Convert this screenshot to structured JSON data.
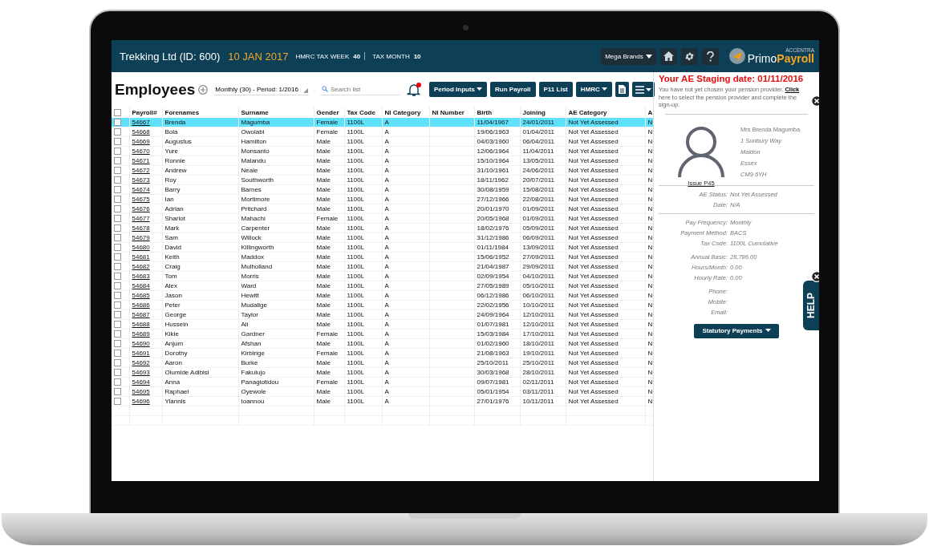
{
  "header": {
    "company": "Trekking Ltd (ID: 600)",
    "date": "10 JAN 2017",
    "tax_week_label": "HMRC TAX WEEK",
    "tax_week": "40",
    "tax_month_label": "TAX MONTH",
    "tax_month": "10",
    "company_select": "Mega Brands",
    "logo_small": "ACCENTRA",
    "logo_name": [
      "Primo",
      "Payroll"
    ]
  },
  "toolbar": {
    "title": "Employees",
    "period_select": "Monthly (30) - Period: 1/2016",
    "search": {
      "placeholder": "Search list"
    },
    "notification": true,
    "buttons": [
      {
        "label": "Period Inputs",
        "dropdown": true
      },
      {
        "label": "Run Payroll",
        "dropdown": false
      },
      {
        "label": "P11 List",
        "dropdown": false
      },
      {
        "label": "HMRC",
        "dropdown": true
      }
    ]
  },
  "table": {
    "all_checked": false,
    "columns": [
      "Payroll#",
      "Forenames",
      "Surname",
      "Gender",
      "Tax Code",
      "NI Category",
      "NI Number",
      "Birth",
      "Joining",
      "AE Category",
      "A"
    ],
    "rows": [
      {
        "selected": true,
        "checked": false,
        "cells": [
          "54667",
          "Brenda",
          "Magumba",
          "Female",
          "1100L",
          "A",
          "",
          "11/04/1967",
          "24/01/2011",
          "Not Yet Assessed",
          "N"
        ]
      },
      {
        "selected": false,
        "checked": false,
        "cells": [
          "54668",
          "Bola",
          "Owolabi",
          "Female",
          "1100L",
          "A",
          "",
          "19/06/1963",
          "01/04/2011",
          "Not Yet Assessed",
          "N"
        ]
      },
      {
        "selected": false,
        "checked": false,
        "cells": [
          "54669",
          "Augustus",
          "Hamilton",
          "Male",
          "1100L",
          "A",
          "",
          "04/03/1960",
          "06/04/2011",
          "Not Yet Assessed",
          "N"
        ]
      },
      {
        "selected": false,
        "checked": false,
        "cells": [
          "54670",
          "Yure",
          "Monsanto",
          "Male",
          "1100L",
          "A",
          "",
          "12/06/1964",
          "11/04/2011",
          "Not Yet Assessed",
          "N"
        ]
      },
      {
        "selected": false,
        "checked": false,
        "cells": [
          "54671",
          "Ronnie",
          "Malandu",
          "Male",
          "1100L",
          "A",
          "",
          "15/10/1964",
          "13/05/2011",
          "Not Yet Assessed",
          "N"
        ]
      },
      {
        "selected": false,
        "checked": false,
        "cells": [
          "54672",
          "Andrew",
          "Neale",
          "Male",
          "1100L",
          "A",
          "",
          "31/10/1961",
          "24/06/2011",
          "Not Yet Assessed",
          "N"
        ]
      },
      {
        "selected": false,
        "checked": false,
        "cells": [
          "54673",
          "Roy",
          "Southworth",
          "Male",
          "1100L",
          "A",
          "",
          "18/11/1962",
          "20/07/2011",
          "Not Yet Assessed",
          "N"
        ]
      },
      {
        "selected": false,
        "checked": false,
        "cells": [
          "54674",
          "Barry",
          "Barnes",
          "Male",
          "1100L",
          "A",
          "",
          "30/08/1959",
          "15/08/2011",
          "Not Yet Assessed",
          "N"
        ]
      },
      {
        "selected": false,
        "checked": false,
        "cells": [
          "54675",
          "Ian",
          "Mortimore",
          "Male",
          "1100L",
          "A",
          "",
          "27/12/1966",
          "22/08/2011",
          "Not Yet Assessed",
          "N"
        ]
      },
      {
        "selected": false,
        "checked": false,
        "cells": [
          "54676",
          "Adrian",
          "Pritchard",
          "Male",
          "1100L",
          "A",
          "",
          "20/01/1970",
          "01/09/2011",
          "Not Yet Assessed",
          "N"
        ]
      },
      {
        "selected": false,
        "checked": false,
        "cells": [
          "54677",
          "Sharlot",
          "Mahachi",
          "Female",
          "1100L",
          "A",
          "",
          "20/05/1968",
          "01/09/2011",
          "Not Yet Assessed",
          "N"
        ]
      },
      {
        "selected": false,
        "checked": false,
        "cells": [
          "54678",
          "Mark",
          "Carpenter",
          "Male",
          "1100L",
          "A",
          "",
          "18/02/1976",
          "05/09/2011",
          "Not Yet Assessed",
          "N"
        ]
      },
      {
        "selected": false,
        "checked": false,
        "cells": [
          "54679",
          "Sam",
          "Willock",
          "Male",
          "1100L",
          "A",
          "",
          "31/12/1986",
          "06/09/2011",
          "Not Yet Assessed",
          "N"
        ]
      },
      {
        "selected": false,
        "checked": false,
        "cells": [
          "54680",
          "David",
          "Killingworth",
          "Male",
          "1100L",
          "A",
          "",
          "01/11/1984",
          "13/09/2011",
          "Not Yet Assessed",
          "N"
        ]
      },
      {
        "selected": false,
        "checked": false,
        "cells": [
          "54681",
          "Keith",
          "Maddox",
          "Male",
          "1100L",
          "A",
          "",
          "15/06/1952",
          "27/09/2011",
          "Not Yet Assessed",
          "N"
        ]
      },
      {
        "selected": false,
        "checked": false,
        "cells": [
          "54682",
          "Craig",
          "Mulholland",
          "Male",
          "1100L",
          "A",
          "",
          "21/04/1987",
          "29/09/2011",
          "Not Yet Assessed",
          "N"
        ]
      },
      {
        "selected": false,
        "checked": false,
        "cells": [
          "54683",
          "Tom",
          "Morris",
          "Male",
          "1100L",
          "A",
          "",
          "02/09/1954",
          "04/10/2011",
          "Not Yet Assessed",
          "N"
        ]
      },
      {
        "selected": false,
        "checked": false,
        "cells": [
          "54684",
          "Alex",
          "Ward",
          "Male",
          "1100L",
          "A",
          "",
          "27/05/1989",
          "05/10/2011",
          "Not Yet Assessed",
          "N"
        ]
      },
      {
        "selected": false,
        "checked": false,
        "cells": [
          "54685",
          "Jason",
          "Hewitt",
          "Male",
          "1100L",
          "A",
          "",
          "06/12/1986",
          "06/10/2011",
          "Not Yet Assessed",
          "N"
        ]
      },
      {
        "selected": false,
        "checked": false,
        "cells": [
          "54686",
          "Peter",
          "Mudalige",
          "Male",
          "1100L",
          "A",
          "",
          "22/02/1956",
          "10/10/2011",
          "Not Yet Assessed",
          "N"
        ]
      },
      {
        "selected": false,
        "checked": false,
        "cells": [
          "54687",
          "George",
          "Taylor",
          "Male",
          "1100L",
          "A",
          "",
          "24/09/1964",
          "12/10/2011",
          "Not Yet Assessed",
          "N"
        ]
      },
      {
        "selected": false,
        "checked": false,
        "cells": [
          "54688",
          "Hussein",
          "Ali",
          "Male",
          "1100L",
          "A",
          "",
          "01/07/1981",
          "12/10/2011",
          "Not Yet Assessed",
          "N"
        ]
      },
      {
        "selected": false,
        "checked": false,
        "cells": [
          "54689",
          "Kikie",
          "Gardner",
          "Female",
          "1100L",
          "A",
          "",
          "15/03/1984",
          "17/10/2011",
          "Not Yet Assessed",
          "N"
        ]
      },
      {
        "selected": false,
        "checked": false,
        "cells": [
          "54690",
          "Anjum",
          "Afshan",
          "Male",
          "1100L",
          "A",
          "",
          "01/02/1960",
          "18/10/2011",
          "Not Yet Assessed",
          "N"
        ]
      },
      {
        "selected": false,
        "checked": false,
        "cells": [
          "54691",
          "Dorothy",
          "Kirbirige",
          "Female",
          "1100L",
          "A",
          "",
          "21/08/1963",
          "19/10/2011",
          "Not Yet Assessed",
          "N"
        ]
      },
      {
        "selected": false,
        "checked": false,
        "cells": [
          "54692",
          "Aaron",
          "Burke",
          "Male",
          "1100L",
          "A",
          "",
          "25/10/2011",
          "25/10/2011",
          "Not Yet Assessed",
          "N"
        ]
      },
      {
        "selected": false,
        "checked": false,
        "cells": [
          "54693",
          "Olumide Adibisi",
          "Fakulujo",
          "Male",
          "1100L",
          "A",
          "",
          "30/03/1968",
          "28/10/2011",
          "Not Yet Assessed",
          "N"
        ]
      },
      {
        "selected": false,
        "checked": false,
        "cells": [
          "54694",
          "Anna",
          "Panagiotidou",
          "Female",
          "1100L",
          "A",
          "",
          "09/07/1981",
          "02/11/2011",
          "Not Yet Assessed",
          "N"
        ]
      },
      {
        "selected": false,
        "checked": false,
        "cells": [
          "54695",
          "Raphael",
          "Oyewole",
          "Male",
          "1100L",
          "A",
          "",
          "05/01/1954",
          "03/11/2011",
          "Not Yet Assessed",
          "N"
        ]
      },
      {
        "selected": false,
        "checked": false,
        "cells": [
          "54696",
          "Yiannis",
          "Ioannou",
          "Male",
          "1100L",
          "A",
          "",
          "27/01/1976",
          "10/11/2011",
          "Not Yet Assessed",
          "N"
        ]
      }
    ]
  },
  "employee_panel": {
    "staging_title": "Your AE Staging date: 01/11/2016",
    "notice": {
      "before": "You have not yet chosen your pension provider.",
      "link": "Click",
      "after": "here to select the pension provider and complete the sign-up."
    },
    "name": "Mrs Brenda Magumba",
    "address": [
      "1 Sunbury Way",
      "Maldon",
      "Essex",
      "CM9 6YH"
    ],
    "issue_link": "Issue P45",
    "detail_groups": [
      {
        "rule": true,
        "rows": [
          {
            "label": "AE Status:",
            "value": "Not Yet Assessed"
          },
          {
            "label": "Date:",
            "value": "N/A"
          }
        ]
      },
      {
        "rule": true,
        "rows": [
          {
            "label": "Pay Frequency:",
            "value": "Monthly"
          },
          {
            "label": "Payment Method:",
            "value": "BACS"
          },
          {
            "label": "Tax Code:",
            "value": "1100L Cumulative"
          }
        ]
      },
      {
        "rule": false,
        "rows": [
          {
            "label": "Annual Basic:",
            "value": "28,786.00"
          },
          {
            "label": "Hours/Month:",
            "value": "0.00"
          },
          {
            "label": "Hourly Rate:",
            "value": "0.00"
          }
        ]
      },
      {
        "rule": false,
        "rows": [
          {
            "label": "Phone:",
            "value": ""
          },
          {
            "label": "Mobile:",
            "value": ""
          },
          {
            "label": "Email:",
            "value": ""
          }
        ]
      }
    ],
    "statutory_button": "Statutory Payments"
  },
  "help_tab": {
    "label": "HELP"
  }
}
